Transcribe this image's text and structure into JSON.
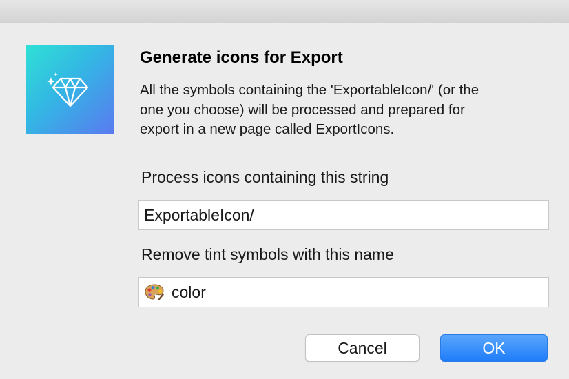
{
  "dialog": {
    "title": "Generate icons for Export",
    "message_lines": [
      "All the symbols containing the 'ExportableIcon/' (or the",
      "one you choose) will be processed and prepared for",
      "export in a new page called ExportIcons."
    ],
    "icon": "sketch-diamond-icon"
  },
  "fields": {
    "process_label": "Process icons containing this string",
    "process_value": "ExportableIcon/",
    "remove_label": "Remove tint symbols with this name",
    "remove_value": "color",
    "remove_icon": "palette-emoji-icon"
  },
  "buttons": {
    "cancel_label": "Cancel",
    "ok_label": "OK"
  },
  "colors": {
    "accent": "#1f7df9",
    "icon_gradient_start": "#2fe0d6",
    "icon_gradient_end": "#5a7af0"
  }
}
